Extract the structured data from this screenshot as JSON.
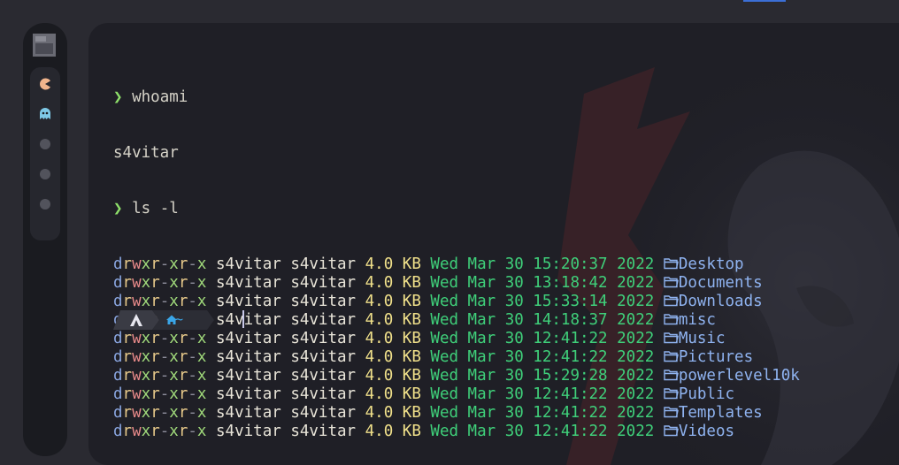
{
  "commands": [
    {
      "prompt": "❯",
      "text": "whoami"
    },
    {
      "output": "s4vitar"
    },
    {
      "prompt": "❯",
      "text": "ls -l"
    }
  ],
  "whoami_cmd": "whoami",
  "whoami_output": "s4vitar",
  "ls_cmd": "ls -l",
  "prompt_symbol": "❯",
  "listing": [
    {
      "perm": "drwxr-xr-x",
      "user": "s4vitar",
      "group": "s4vitar",
      "size": "4.0 KB",
      "date": "Wed Mar 30 15:20:37 2022",
      "name": "Desktop"
    },
    {
      "perm": "drwxr-xr-x",
      "user": "s4vitar",
      "group": "s4vitar",
      "size": "4.0 KB",
      "date": "Wed Mar 30 13:18:42 2022",
      "name": "Documents"
    },
    {
      "perm": "drwxr-xr-x",
      "user": "s4vitar",
      "group": "s4vitar",
      "size": "4.0 KB",
      "date": "Wed Mar 30 15:33:14 2022",
      "name": "Downloads"
    },
    {
      "perm": "drwxr-xr-x",
      "user": "s4vitar",
      "group": "s4vitar",
      "size": "4.0 KB",
      "date": "Wed Mar 30 14:18:37 2022",
      "name": "misc"
    },
    {
      "perm": "drwxr-xr-x",
      "user": "s4vitar",
      "group": "s4vitar",
      "size": "4.0 KB",
      "date": "Wed Mar 30 12:41:22 2022",
      "name": "Music"
    },
    {
      "perm": "drwxr-xr-x",
      "user": "s4vitar",
      "group": "s4vitar",
      "size": "4.0 KB",
      "date": "Wed Mar 30 12:41:22 2022",
      "name": "Pictures"
    },
    {
      "perm": "drwxr-xr-x",
      "user": "s4vitar",
      "group": "s4vitar",
      "size": "4.0 KB",
      "date": "Wed Mar 30 15:29:28 2022",
      "name": "powerlevel10k"
    },
    {
      "perm": "drwxr-xr-x",
      "user": "s4vitar",
      "group": "s4vitar",
      "size": "4.0 KB",
      "date": "Wed Mar 30 12:41:22 2022",
      "name": "Public"
    },
    {
      "perm": "drwxr-xr-x",
      "user": "s4vitar",
      "group": "s4vitar",
      "size": "4.0 KB",
      "date": "Wed Mar 30 12:41:22 2022",
      "name": "Templates"
    },
    {
      "perm": "drwxr-xr-x",
      "user": "s4vitar",
      "group": "s4vitar",
      "size": "4.0 KB",
      "date": "Wed Mar 30 12:41:22 2022",
      "name": "Videos"
    }
  ],
  "prompt_bar": {
    "home_label": "~"
  },
  "workspaces": [
    {
      "icon": "pacman-icon"
    },
    {
      "icon": "ghost-icon"
    },
    {
      "icon": "dot-icon"
    },
    {
      "icon": "dot-icon"
    },
    {
      "icon": "dot-icon"
    }
  ],
  "colors": {
    "background": "#1f1f26",
    "sidebar": "#1a1b20",
    "date": "#3fd07a",
    "size": "#f0e08a",
    "name": "#8fb3f0",
    "prompt": "#8ee06a"
  }
}
